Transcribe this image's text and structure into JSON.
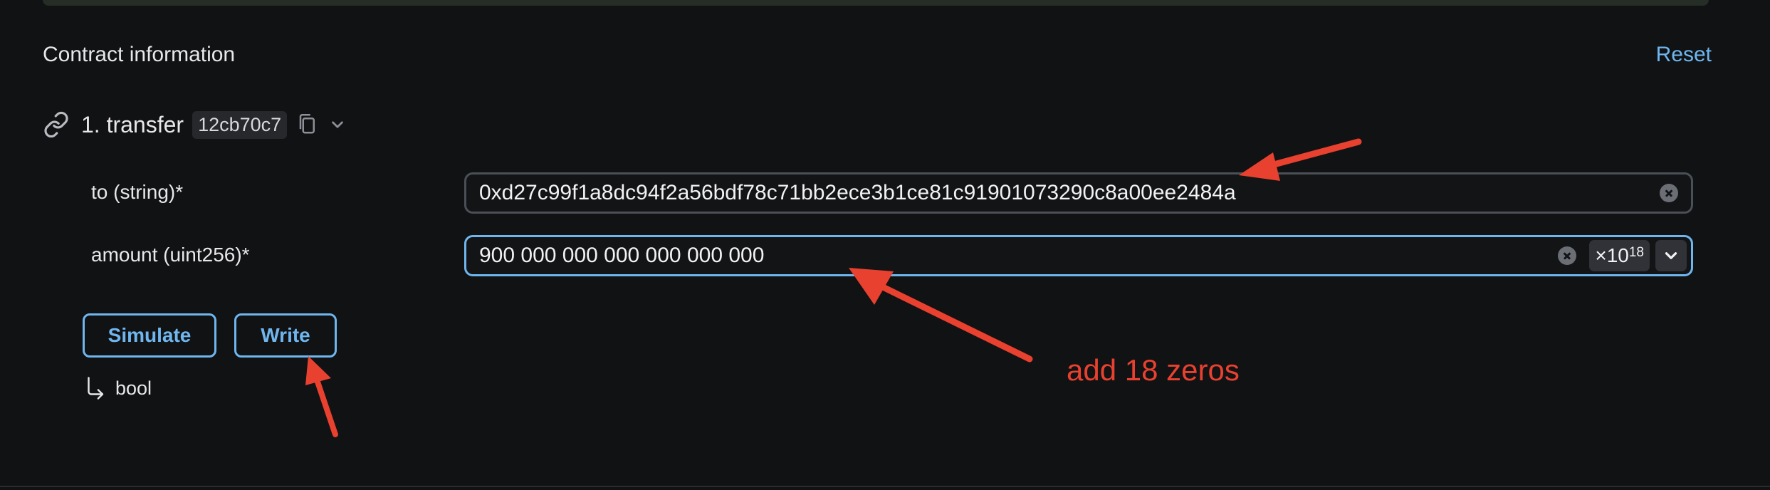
{
  "section": {
    "title": "Contract information",
    "reset_label": "Reset"
  },
  "function": {
    "name": "1. transfer",
    "selector": "12cb70c7",
    "icons": [
      "link-icon",
      "copy-icon",
      "chevron-down-icon"
    ]
  },
  "params": {
    "to": {
      "label": "to (string)*",
      "value": "0xd27c99f1a8dc94f2a56bdf78c71bb2ece3b1ce81c91901073290c8a00ee2484a"
    },
    "amount": {
      "label": "amount (uint256)*",
      "value": "900 000 000 000 000 000 000",
      "unit_prefix": "×10",
      "unit_exponent": "18"
    }
  },
  "buttons": {
    "simulate": "Simulate",
    "write": "Write"
  },
  "return": {
    "type": "bool"
  },
  "annotation": {
    "text": "add 18 zeros",
    "color": "#e8412f"
  },
  "colors": {
    "accent": "#6fb6ef",
    "background": "#111214",
    "annotation": "#e8412f"
  }
}
